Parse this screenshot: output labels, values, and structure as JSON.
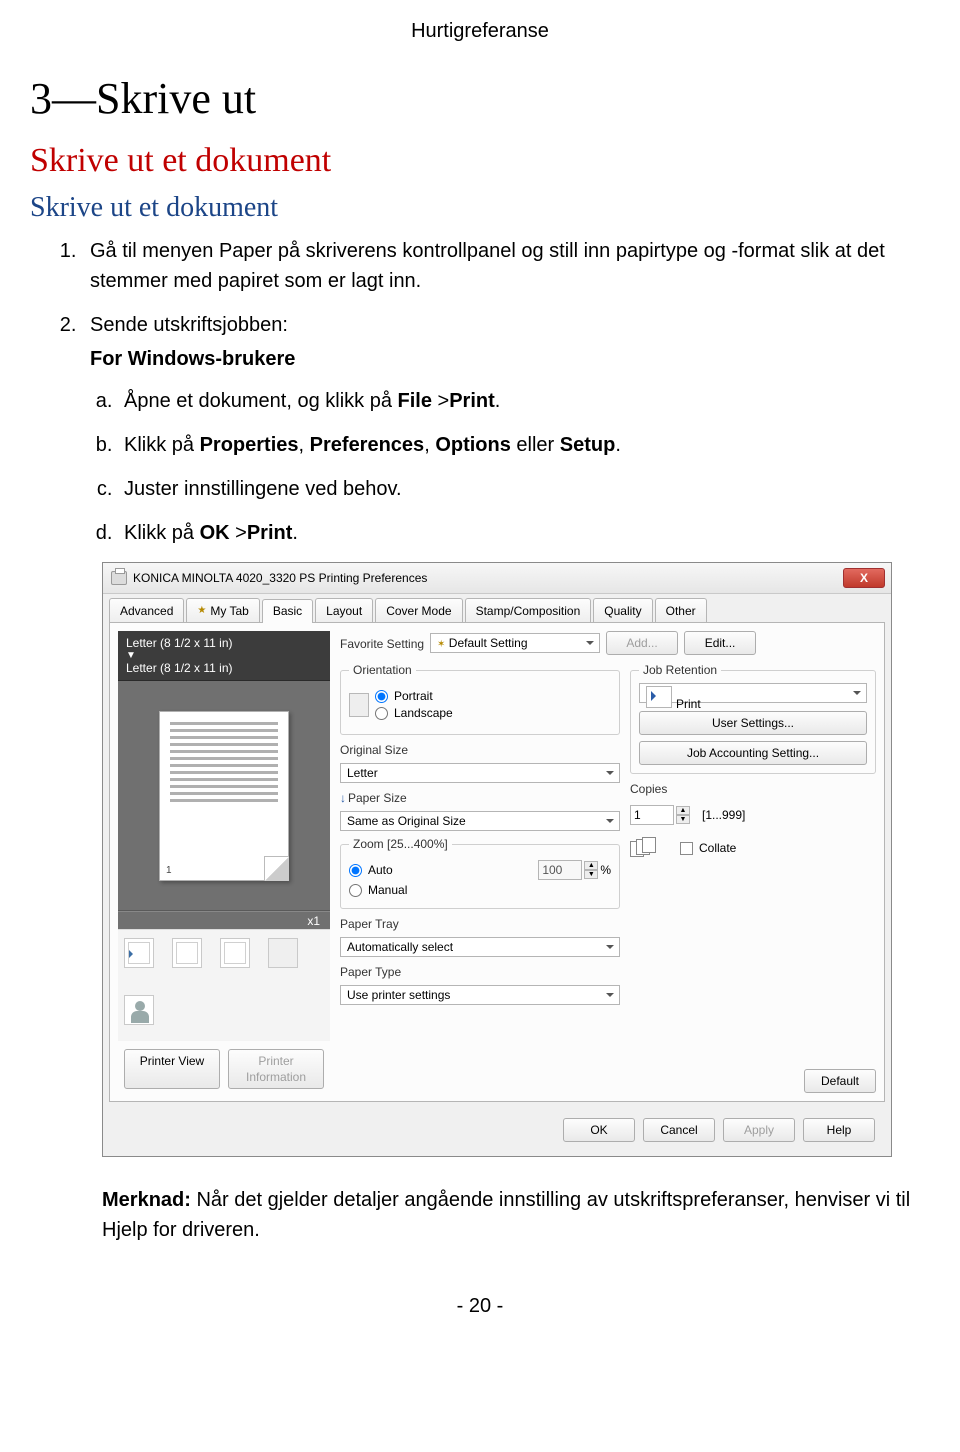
{
  "header": "Hurtigreferanse",
  "chapter_title": "3—Skrive ut",
  "section_title": "Skrive ut et dokument",
  "subsection_title": "Skrive ut et dokument",
  "step1": "Gå til menyen Paper på skriverens kontrollpanel og still inn papirtype og -format slik at det stemmer med papiret som er lagt inn.",
  "step2": "Sende utskriftsjobben:",
  "step2_sub_heading": "For Windows-brukere",
  "step_a_pre": "Åpne et dokument, og klikk på ",
  "step_a_b1": "File",
  "step_a_mid": " >",
  "step_a_b2": "Print",
  "step_a_post": ".",
  "step_b_pre": "Klikk på ",
  "step_b_b1": "Properties",
  "step_b_sep1": ", ",
  "step_b_b2": "Preferences",
  "step_b_sep2": ", ",
  "step_b_b3": "Options",
  "step_b_sep3": " eller ",
  "step_b_b4": "Setup",
  "step_b_post": ".",
  "step_c": "Juster innstillingene ved behov.",
  "step_d_pre": "Klikk på ",
  "step_d_b1": "OK",
  "step_d_mid": " >",
  "step_d_b2": "Print",
  "step_d_post": ".",
  "dialog": {
    "title": "KONICA MINOLTA 4020_3320 PS Printing Preferences",
    "close_x": "X",
    "tabs": [
      "Advanced",
      "My Tab",
      "Basic",
      "Layout",
      "Cover Mode",
      "Stamp/Composition",
      "Quality",
      "Other"
    ],
    "left": {
      "line1": "Letter (8 1/2 x 11 in)",
      "arrow": "▼",
      "line2": "Letter (8 1/2 x 11 in)",
      "page_num": "1",
      "x1": "x1",
      "printer_view": "Printer View",
      "printer_info": "Printer Information"
    },
    "mid": {
      "favorite_label": "Favorite Setting",
      "favorite_value": "Default Setting",
      "add": "Add...",
      "edit": "Edit...",
      "orientation_legend": "Orientation",
      "portrait": "Portrait",
      "landscape": "Landscape",
      "original_size_label": "Original Size",
      "original_size_value": "Letter",
      "paper_size_label": "Paper Size",
      "paper_size_value": "Same as Original Size",
      "zoom_label": "Zoom [25...400%]",
      "zoom_auto": "Auto",
      "zoom_manual": "Manual",
      "zoom_value": "100",
      "zoom_pct": "%",
      "paper_tray_label": "Paper Tray",
      "paper_tray_value": "Automatically select",
      "paper_type_label": "Paper Type",
      "paper_type_value": "Use printer settings"
    },
    "right": {
      "job_legend": "Job Retention",
      "job_value": "Print",
      "user_settings": "User Settings...",
      "job_acct": "Job Accounting Setting...",
      "copies_label": "Copies",
      "copies_value": "1",
      "copies_range": "[1...999]",
      "collate": "Collate",
      "default": "Default"
    },
    "bottom": {
      "ok": "OK",
      "cancel": "Cancel",
      "apply": "Apply",
      "help": "Help"
    }
  },
  "note_b": "Merknad:",
  "note_text": " Når det gjelder detaljer angående innstilling av utskriftspreferanser, henviser vi til Hjelp for driveren.",
  "footer": "- 20 -"
}
